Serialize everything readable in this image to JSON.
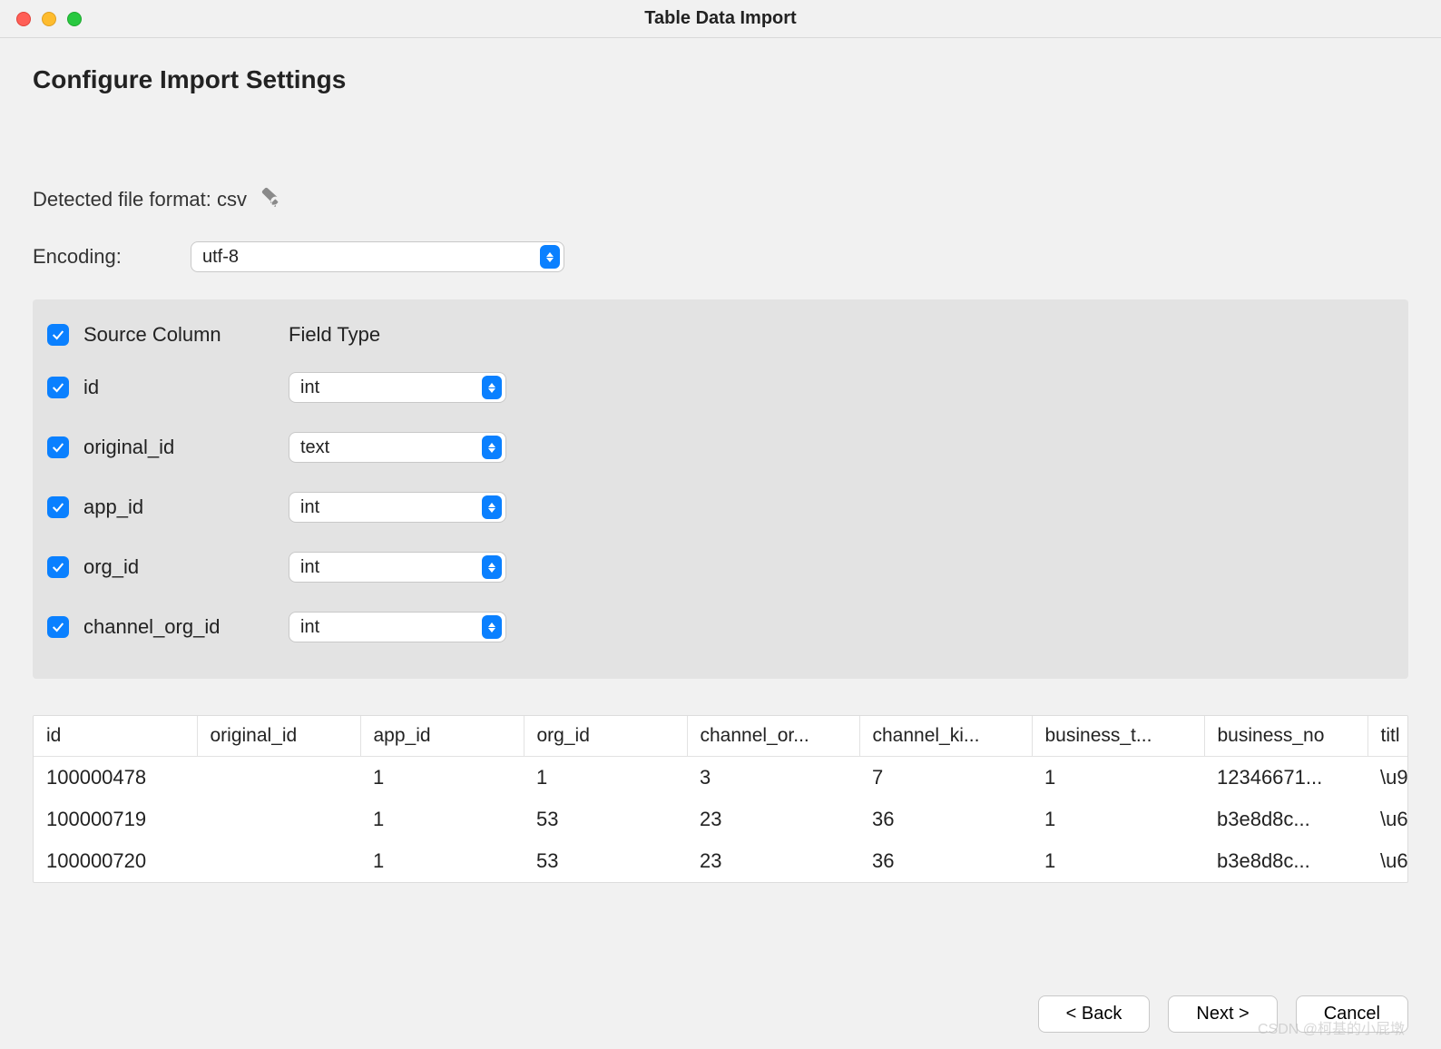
{
  "titlebar": {
    "title": "Table Data Import"
  },
  "heading": "Configure Import Settings",
  "detected": {
    "label": "Detected file format: csv"
  },
  "encoding": {
    "label": "Encoding:",
    "value": "utf-8"
  },
  "columns": {
    "header_source": "Source Column",
    "header_fieldtype": "Field Type",
    "rows": [
      {
        "name": "id",
        "type": "int"
      },
      {
        "name": "original_id",
        "type": "text"
      },
      {
        "name": "app_id",
        "type": "int"
      },
      {
        "name": "org_id",
        "type": "int"
      },
      {
        "name": "channel_org_id",
        "type": "int"
      }
    ]
  },
  "preview": {
    "headers": [
      "id",
      "original_id",
      "app_id",
      "org_id",
      "channel_or...",
      "channel_ki...",
      "business_t...",
      "business_no",
      "titl"
    ],
    "rows": [
      [
        "100000478",
        "",
        "1",
        "1",
        "3",
        "7",
        "1",
        "12346671...",
        "\\u9"
      ],
      [
        "100000719",
        "",
        "1",
        "53",
        "23",
        "36",
        "1",
        "b3e8d8c...",
        "\\u6"
      ],
      [
        "100000720",
        "",
        "1",
        "53",
        "23",
        "36",
        "1",
        "b3e8d8c...",
        "\\u6"
      ]
    ]
  },
  "footer": {
    "back": "< Back",
    "next": "Next >",
    "cancel": "Cancel"
  },
  "watermark": "CSDN @柯基的小屁墩"
}
